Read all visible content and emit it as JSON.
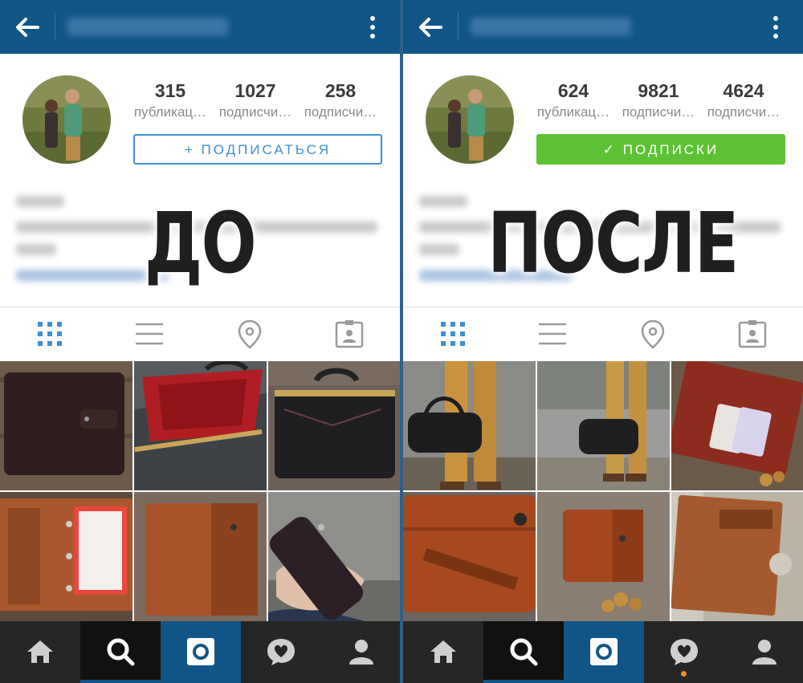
{
  "panels": [
    {
      "id": "left",
      "username": "pavel_matrosov",
      "stats": [
        {
          "value": "315",
          "label": "публикац…"
        },
        {
          "value": "1027",
          "label": "подписчи…"
        },
        {
          "value": "258",
          "label": "подписчи…"
        }
      ],
      "follow_button": {
        "label": "+ ПОДПИСАТЬСЯ",
        "style": "outline",
        "color": "#3f8fd4"
      },
      "overlay_text": "ДО",
      "bottom_nav": [
        "home-icon",
        "search-icon",
        "camera-icon",
        "activity-icon",
        "profile-icon"
      ],
      "grid": [
        "dark leather planner",
        "red-lined leather bag",
        "black leather doctor bag",
        "open tan planner",
        "tan leather folio",
        "dark phone pouch in hand"
      ]
    },
    {
      "id": "right",
      "username": "pavel_matrosov",
      "stats": [
        {
          "value": "624",
          "label": "публикац…"
        },
        {
          "value": "9821",
          "label": "подписчи…"
        },
        {
          "value": "4624",
          "label": "подписчи…"
        }
      ],
      "follow_button": {
        "label": "✓ ПОДПИСКИ",
        "style": "filled",
        "color": "#5cc133"
      },
      "overlay_text": "ПОСЛЕ",
      "bottom_nav": [
        "home-icon",
        "search-icon",
        "camera-icon",
        "activity-icon",
        "profile-icon"
      ],
      "grid": [
        "man with black duffel bag",
        "man with duffel bag outdoors",
        "wallet with cards",
        "embossed leather wallet",
        "small wallet with coins",
        "leather book cover"
      ]
    }
  ],
  "colors": {
    "topbar": "#125688",
    "active_tab": "#3f8fd4",
    "inactive_tab": "#9a9a9a",
    "bottom_nav": "#262626",
    "notification_dot": "#f58a2c"
  }
}
